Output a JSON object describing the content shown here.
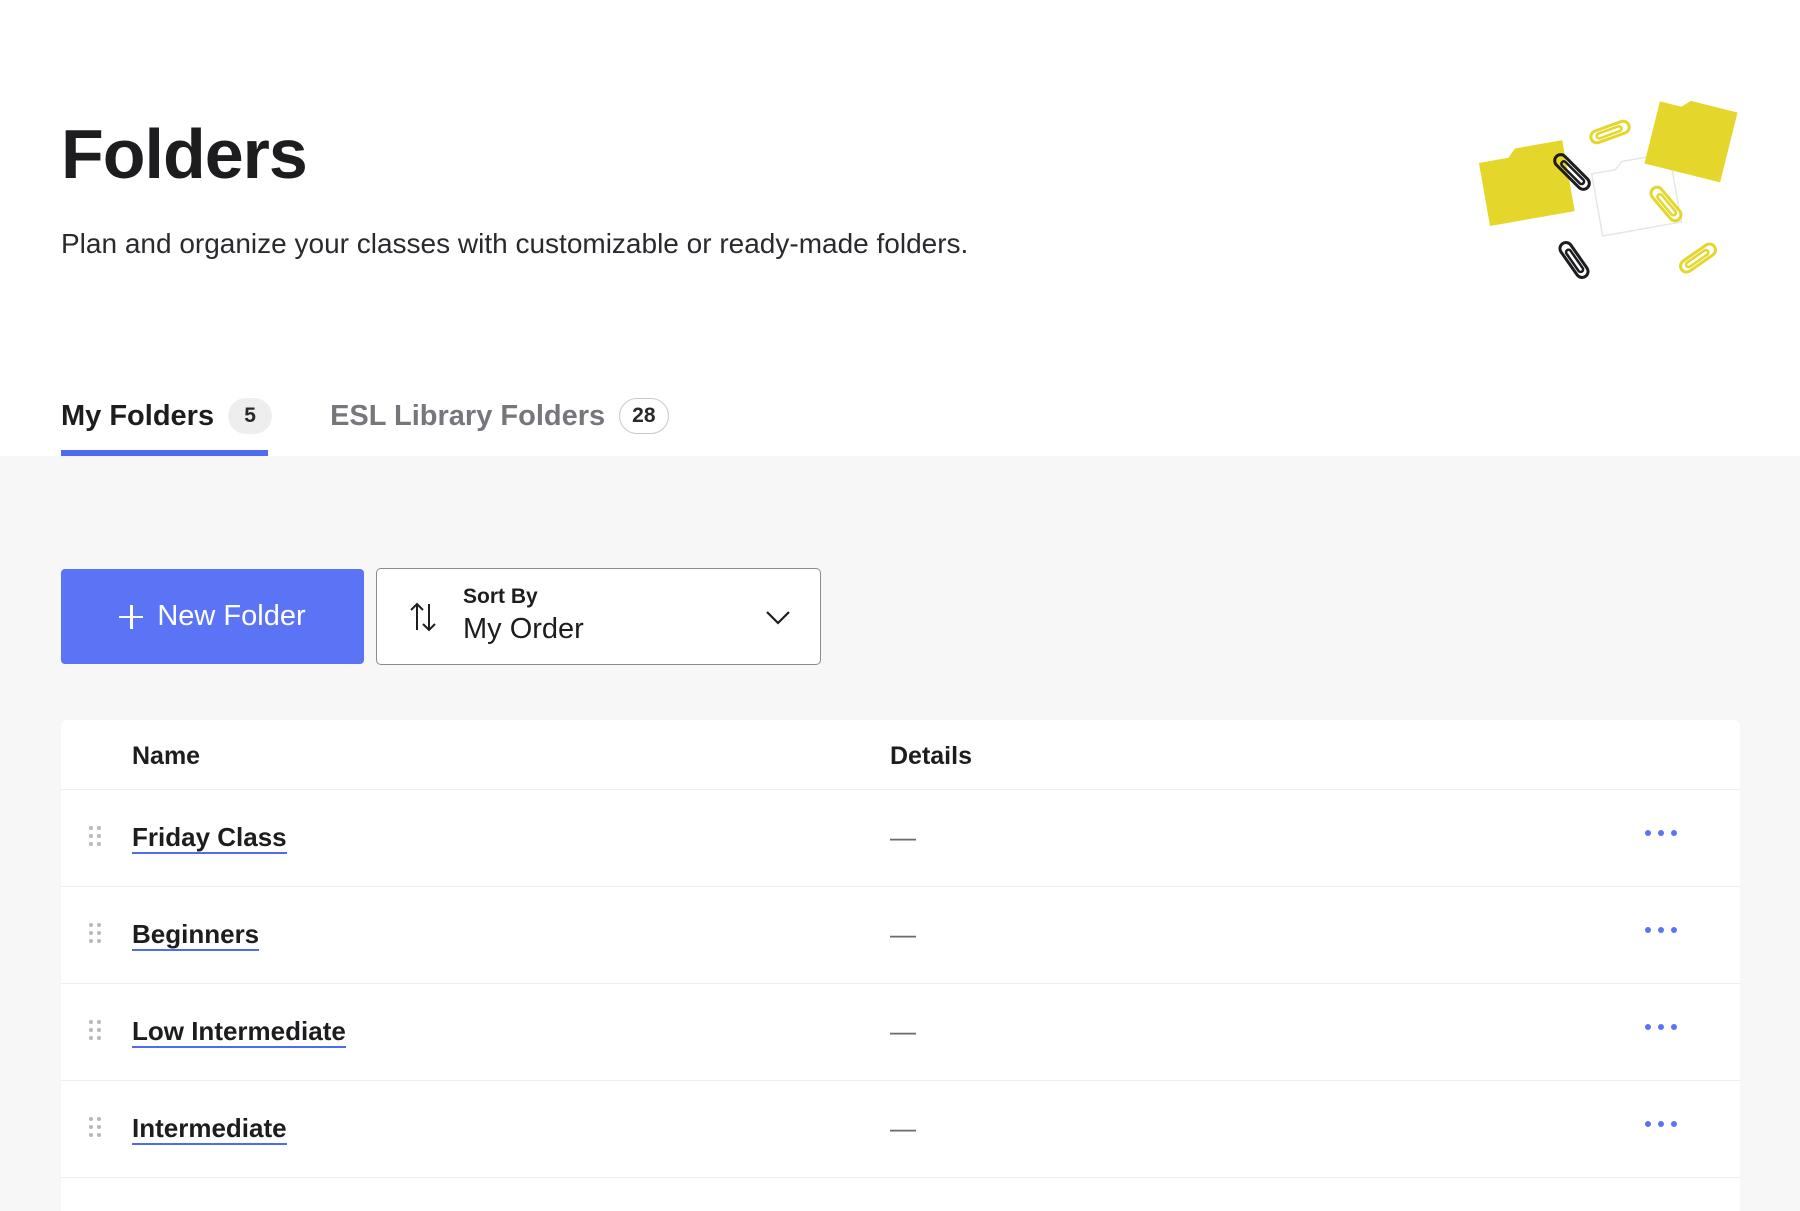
{
  "header": {
    "title": "Folders",
    "subtitle": "Plan and organize your classes with customizable or ready-made folders."
  },
  "illustration": {
    "icon": "folders-paperclips-illustration"
  },
  "tabs": [
    {
      "label": "My Folders",
      "count": "5",
      "active": true
    },
    {
      "label": "ESL Library Folders",
      "count": "28",
      "active": false
    }
  ],
  "toolbar": {
    "new_folder_label": "New Folder",
    "sort_label": "Sort By",
    "sort_value": "My Order"
  },
  "table": {
    "columns": {
      "name": "Name",
      "details": "Details"
    },
    "rows": [
      {
        "name": "Friday Class",
        "details": "—"
      },
      {
        "name": "Beginners",
        "details": "—"
      },
      {
        "name": "Low Intermediate",
        "details": "—"
      },
      {
        "name": "Intermediate",
        "details": "—"
      }
    ]
  },
  "colors": {
    "accent": "#5b74f5",
    "underline": "#4f6bf2",
    "illustration_yellow": "#e4d62a",
    "content_bg": "#f7f7f7"
  }
}
